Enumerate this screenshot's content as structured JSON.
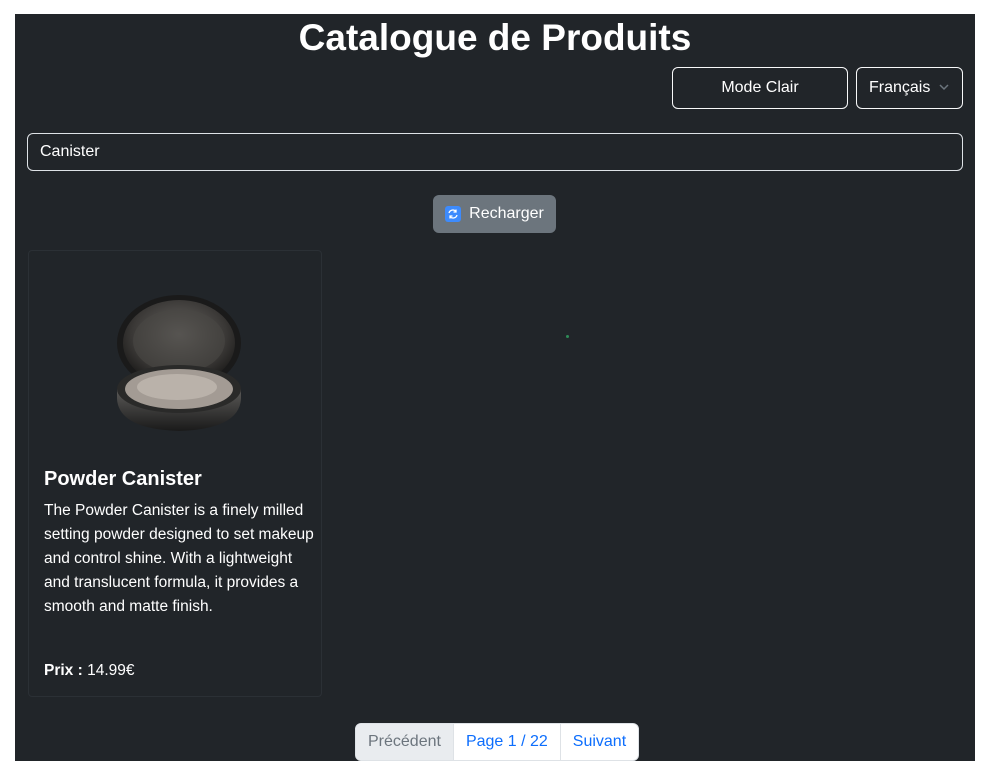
{
  "header": {
    "title": "Catalogue de Produits"
  },
  "controls": {
    "mode_label": "Mode Clair",
    "language_value": "Français"
  },
  "search": {
    "value": "Canister",
    "placeholder": ""
  },
  "reload": {
    "label": "Recharger",
    "icon": "reload-icon"
  },
  "products": [
    {
      "name": "Powder Canister",
      "description": "The Powder Canister is a finely milled setting powder designed to set makeup and control shine. With a lightweight and translucent formula, it provides a smooth and matte finish.",
      "price_label": "Prix :",
      "price": "14.99€",
      "image": "powder-compact-image"
    }
  ],
  "pagination": {
    "prev_label": "Précédent",
    "page_label": "Page 1 / 22",
    "next_label": "Suivant"
  },
  "colors": {
    "background": "#212529",
    "accent": "#0d6efd",
    "reload_button": "#6c757d"
  }
}
